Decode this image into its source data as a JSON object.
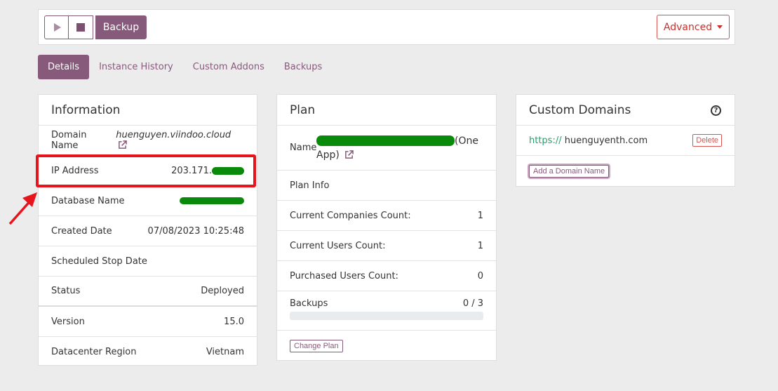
{
  "toolbar": {
    "play_icon": "play-icon",
    "stop_icon": "stop-icon",
    "backup_label": "Backup",
    "advanced_label": "Advanced"
  },
  "tabs": [
    {
      "label": "Details",
      "active": true
    },
    {
      "label": "Instance History"
    },
    {
      "label": "Custom Addons"
    },
    {
      "label": "Backups"
    }
  ],
  "information": {
    "title": "Information",
    "domain_label": "Domain Name",
    "domain_value": "huenguyen.viindoo.cloud",
    "ip_label": "IP Address",
    "ip_value": "203.171.",
    "db_label": "Database Name",
    "created_label": "Created Date",
    "created_value": "07/08/2023 10:25:48",
    "stop_label": "Scheduled Stop Date",
    "stop_value": "",
    "status_label": "Status",
    "status_value": "Deployed",
    "version_label": "Version",
    "version_value": "15.0",
    "region_label": "Datacenter Region",
    "region_value": "Vietnam"
  },
  "plan": {
    "title": "Plan",
    "name_label": "Name",
    "name_suffix_1": "(One",
    "name_suffix_2": "App)",
    "plan_info_label": "Plan Info",
    "companies_label": "Current Companies Count:",
    "companies_value": "1",
    "users_label": "Current Users Count:",
    "users_value": "1",
    "purchased_label": "Purchased Users Count:",
    "purchased_value": "0",
    "backups_label": "Backups",
    "backups_value": "0 / 3",
    "backups_used": 0,
    "change_plan_label": "Change Plan"
  },
  "custom_domains": {
    "title": "Custom Domains",
    "help_glyph": "?",
    "domain_protocol": "https://",
    "domain_host": "huenguyenth.com",
    "delete_label": "Delete",
    "add_label": "Add a Domain Name"
  },
  "colors": {
    "brand": "#875a7b",
    "danger": "#d9534f",
    "redaction": "#0a8a0a",
    "annotation": "#e8141c",
    "protocol": "#28a06b"
  }
}
